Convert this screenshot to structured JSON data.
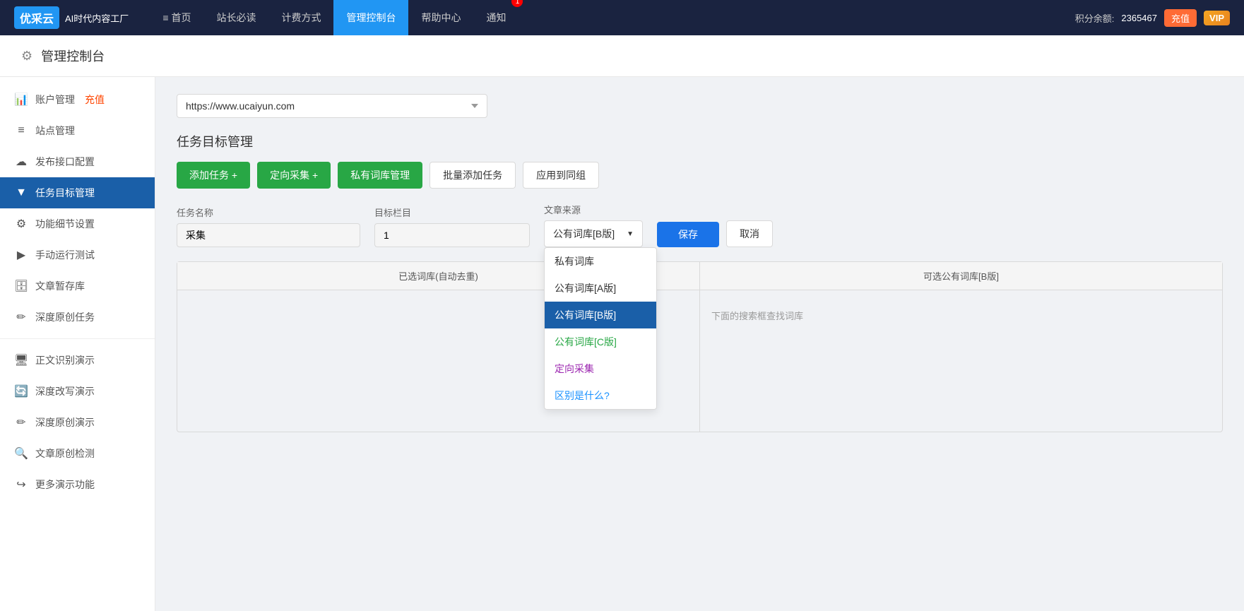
{
  "brand": {
    "logo_text": "优采云",
    "subtitle": "AI时代内容工厂"
  },
  "topnav": {
    "items": [
      {
        "id": "home",
        "label": "首页",
        "icon": "≡",
        "active": false
      },
      {
        "id": "webmaster",
        "label": "站长必读",
        "icon": "",
        "active": false
      },
      {
        "id": "pricing",
        "label": "计费方式",
        "icon": "",
        "active": false
      },
      {
        "id": "dashboard",
        "label": "管理控制台",
        "icon": "",
        "active": true
      },
      {
        "id": "help",
        "label": "帮助中心",
        "icon": "",
        "active": false
      },
      {
        "id": "notify",
        "label": "通知",
        "icon": "",
        "active": false,
        "badge": "1"
      }
    ],
    "points_label": "积分余额:",
    "points_value": "2365467",
    "recharge_label": "充值",
    "vip_label": "VIP"
  },
  "page": {
    "header_title": "管理控制台"
  },
  "sidebar": {
    "items": [
      {
        "id": "account",
        "label": "账户管理",
        "icon": "📊",
        "suffix": "充值",
        "active": false
      },
      {
        "id": "site",
        "label": "站点管理",
        "icon": "≡",
        "active": false
      },
      {
        "id": "publish",
        "label": "发布接口配置",
        "icon": "☁",
        "active": false
      },
      {
        "id": "task",
        "label": "任务目标管理",
        "icon": "▼",
        "active": true
      },
      {
        "id": "settings",
        "label": "功能细节设置",
        "icon": "⚙",
        "active": false
      },
      {
        "id": "manual",
        "label": "手动运行测试",
        "icon": "▶",
        "active": false
      },
      {
        "id": "draft",
        "label": "文章暂存库",
        "icon": "🗄",
        "active": false
      },
      {
        "id": "original",
        "label": "深度原创任务",
        "icon": "✏",
        "active": false
      }
    ],
    "demo_items": [
      {
        "id": "ocr",
        "label": "正文识别演示",
        "icon": "🖥"
      },
      {
        "id": "rewrite",
        "label": "深度改写演示",
        "icon": "🔄"
      },
      {
        "id": "original_demo",
        "label": "深度原创演示",
        "icon": "✏"
      },
      {
        "id": "check",
        "label": "文章原创检测",
        "icon": "🔍"
      },
      {
        "id": "more",
        "label": "更多演示功能",
        "icon": "↪"
      }
    ]
  },
  "main": {
    "site_url": "https://www.ucaiyun.com",
    "section_title": "任务目标管理",
    "buttons": {
      "add_task": "添加任务 +",
      "directed_collect": "定向采集 +",
      "private_library": "私有词库管理",
      "batch_add": "批量添加任务",
      "apply_group": "应用到同组"
    },
    "form": {
      "task_name_label": "任务名称",
      "task_name_value": "采集",
      "target_column_label": "目标栏目",
      "target_column_value": "1",
      "article_source_label": "文章来源",
      "article_source_value": "公有词库[B版]",
      "save_label": "保存",
      "cancel_label": "取消"
    },
    "dropdown": {
      "options": [
        {
          "id": "private",
          "label": "私有词库",
          "style": "normal"
        },
        {
          "id": "pubA",
          "label": "公有词库[A版]",
          "style": "normal"
        },
        {
          "id": "pubB",
          "label": "公有词库[B版]",
          "style": "selected"
        },
        {
          "id": "pubC",
          "label": "公有词库[C版]",
          "style": "green"
        },
        {
          "id": "directed",
          "label": "定向采集",
          "style": "purple"
        },
        {
          "id": "diff",
          "label": "区别是什么?",
          "style": "blue"
        }
      ]
    },
    "panels": {
      "left_header": "已选词库(自动去重)",
      "right_header": "可选公有词库[B版]",
      "right_hint": "下面的搜索框查找词库"
    }
  }
}
